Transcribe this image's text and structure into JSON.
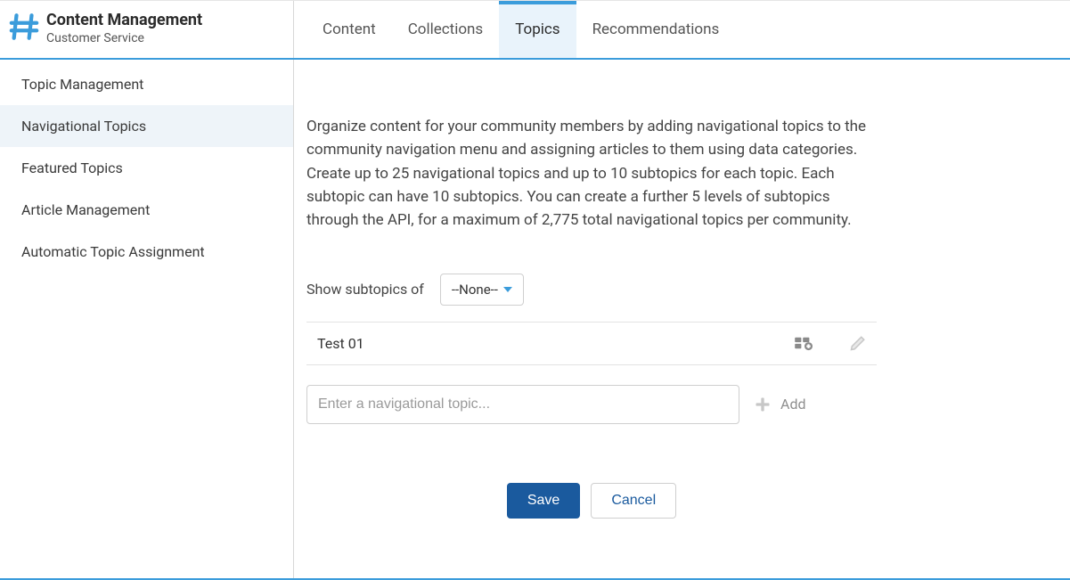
{
  "sidebar": {
    "title": "Content Management",
    "subtitle": "Customer Service",
    "items": [
      {
        "label": "Topic Management",
        "active": false
      },
      {
        "label": "Navigational Topics",
        "active": true
      },
      {
        "label": "Featured Topics",
        "active": false
      },
      {
        "label": "Article Management",
        "active": false
      },
      {
        "label": "Automatic Topic Assignment",
        "active": false
      }
    ]
  },
  "tabs": [
    {
      "label": "Content",
      "active": false
    },
    {
      "label": "Collections",
      "active": false
    },
    {
      "label": "Topics",
      "active": true
    },
    {
      "label": "Recommendations",
      "active": false
    }
  ],
  "main": {
    "description_p1": "Organize content for your community members by adding navigational topics to the community navigation menu and assigning articles to them using data categories.",
    "description_p2": "Create up to 25 navigational topics and up to 10 subtopics for each topic. Each subtopic can have 10 subtopics. You can create a further 5 levels of subtopics through the API, for a maximum of 2,775 total navigational topics per community.",
    "subtopics_label": "Show subtopics of",
    "subtopics_selected": "--None--",
    "topics": [
      {
        "name": "Test 01"
      }
    ],
    "input_placeholder": "Enter a navigational topic...",
    "add_label": "Add",
    "save_label": "Save",
    "cancel_label": "Cancel"
  }
}
